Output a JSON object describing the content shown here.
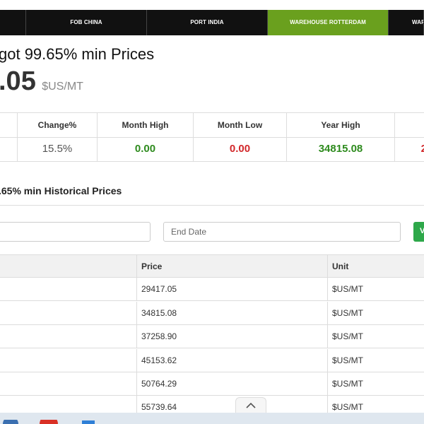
{
  "tabs": [
    {
      "label": "",
      "active": false
    },
    {
      "label": "FOB CHINA",
      "active": false
    },
    {
      "label": "PORT INDIA",
      "active": false
    },
    {
      "label": "WAREHOUSE ROTTERDAM",
      "active": true
    },
    {
      "label": "WAR",
      "active": false
    }
  ],
  "header": {
    "title": "got 99.65% min Prices",
    "price": ".05",
    "unit": "$US/MT"
  },
  "stats": {
    "headers": [
      "",
      "Change%",
      "Month High",
      "Month Low",
      "Year High",
      ""
    ],
    "values": [
      "",
      "15.5%",
      "0.00",
      "0.00",
      "34815.08",
      "2"
    ]
  },
  "historical": {
    "title": ".65% min Historical Prices",
    "start_placeholder": "",
    "end_placeholder": "End Date",
    "go_label": "V"
  },
  "table": {
    "columns": [
      "",
      "Price",
      "Unit"
    ],
    "rows": [
      {
        "date": "",
        "price": "29417.05",
        "unit": "$US/MT"
      },
      {
        "date": "",
        "price": "34815.08",
        "unit": "$US/MT"
      },
      {
        "date": "",
        "price": "37258.90",
        "unit": "$US/MT"
      },
      {
        "date": "",
        "price": "45153.62",
        "unit": "$US/MT"
      },
      {
        "date": "",
        "price": "50764.29",
        "unit": "$US/MT"
      },
      {
        "date": "",
        "price": "55739.64",
        "unit": "$US/MT"
      }
    ]
  },
  "icons": {
    "scroll": "chevron-up-icon"
  },
  "colors": {
    "active_tab": "#6aa01e",
    "positive": "#2e8b1e",
    "negative": "#d2282b",
    "go_button": "#2ea84a"
  }
}
